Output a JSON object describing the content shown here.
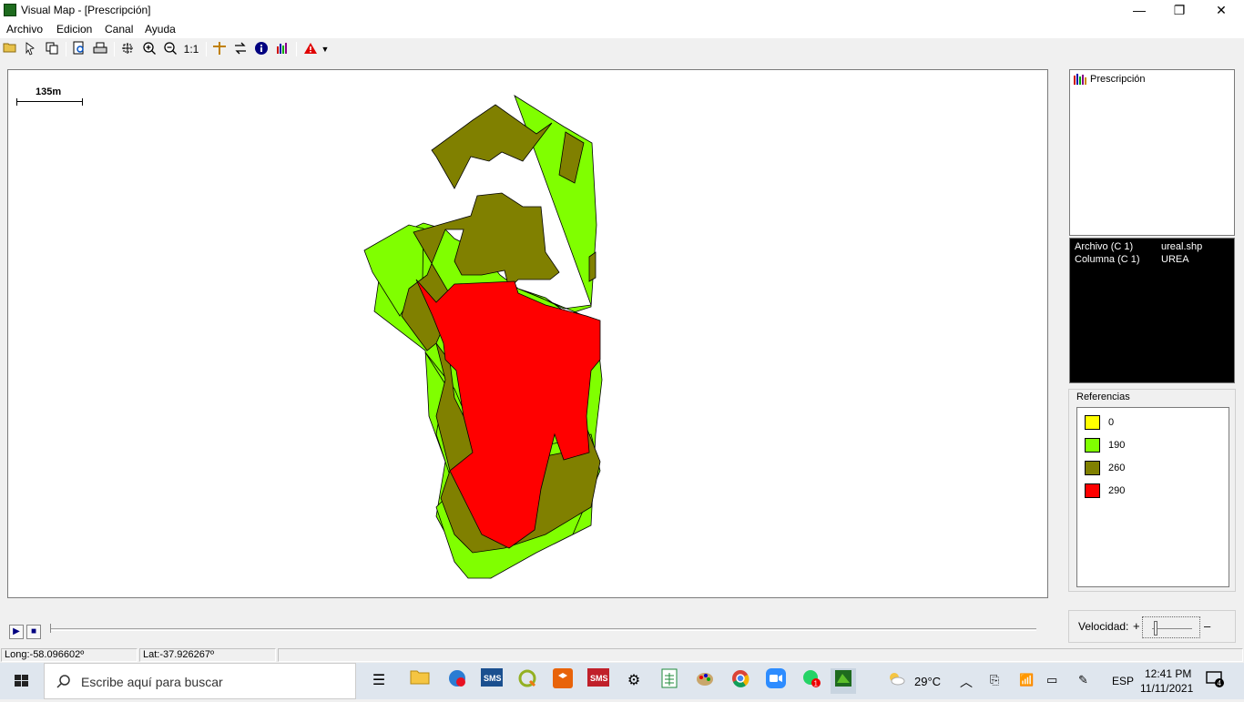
{
  "window": {
    "title": "Visual Map - [Prescripción]",
    "minimize": "—",
    "maximize": "❐",
    "close": "✕"
  },
  "menu": [
    "Archivo",
    "Edicion",
    "Canal",
    "Ayuda"
  ],
  "toolbar": {
    "icons": [
      "open-folder",
      "select",
      "copy",
      "preview",
      "print",
      "zoom-extent",
      "zoom-in",
      "zoom-out",
      "zoom-1-1",
      "crosshair",
      "swap",
      "info",
      "chart",
      "alert"
    ],
    "zoom_one_label": "1:1"
  },
  "map": {
    "scale_label": "135m"
  },
  "layers": {
    "items": [
      {
        "label": "Prescripción"
      }
    ]
  },
  "info": {
    "rows": [
      {
        "label": "Archivo (C 1)",
        "value": "ureal.shp"
      },
      {
        "label": "Columna (C 1)",
        "value": "UREA"
      }
    ]
  },
  "legend": {
    "title": "Referencias",
    "items": [
      {
        "label": "0",
        "color": "#ffff00"
      },
      {
        "label": "190",
        "color": "#80ff00"
      },
      {
        "label": "260",
        "color": "#808000"
      },
      {
        "label": "290",
        "color": "#ff0000"
      }
    ]
  },
  "player": {
    "speed_label": "Velocidad:",
    "plus": "+",
    "minus": "–"
  },
  "status": {
    "long": "Long:-58.096602º",
    "lat": "Lat:-37.926267º"
  },
  "taskbar": {
    "search_placeholder": "Escribe aquí para buscar",
    "weather": "29°C",
    "lang": "ESP",
    "time": "12:41 PM",
    "date": "11/11/2021",
    "notification_count": "4",
    "whatsapp_badge": "1"
  }
}
